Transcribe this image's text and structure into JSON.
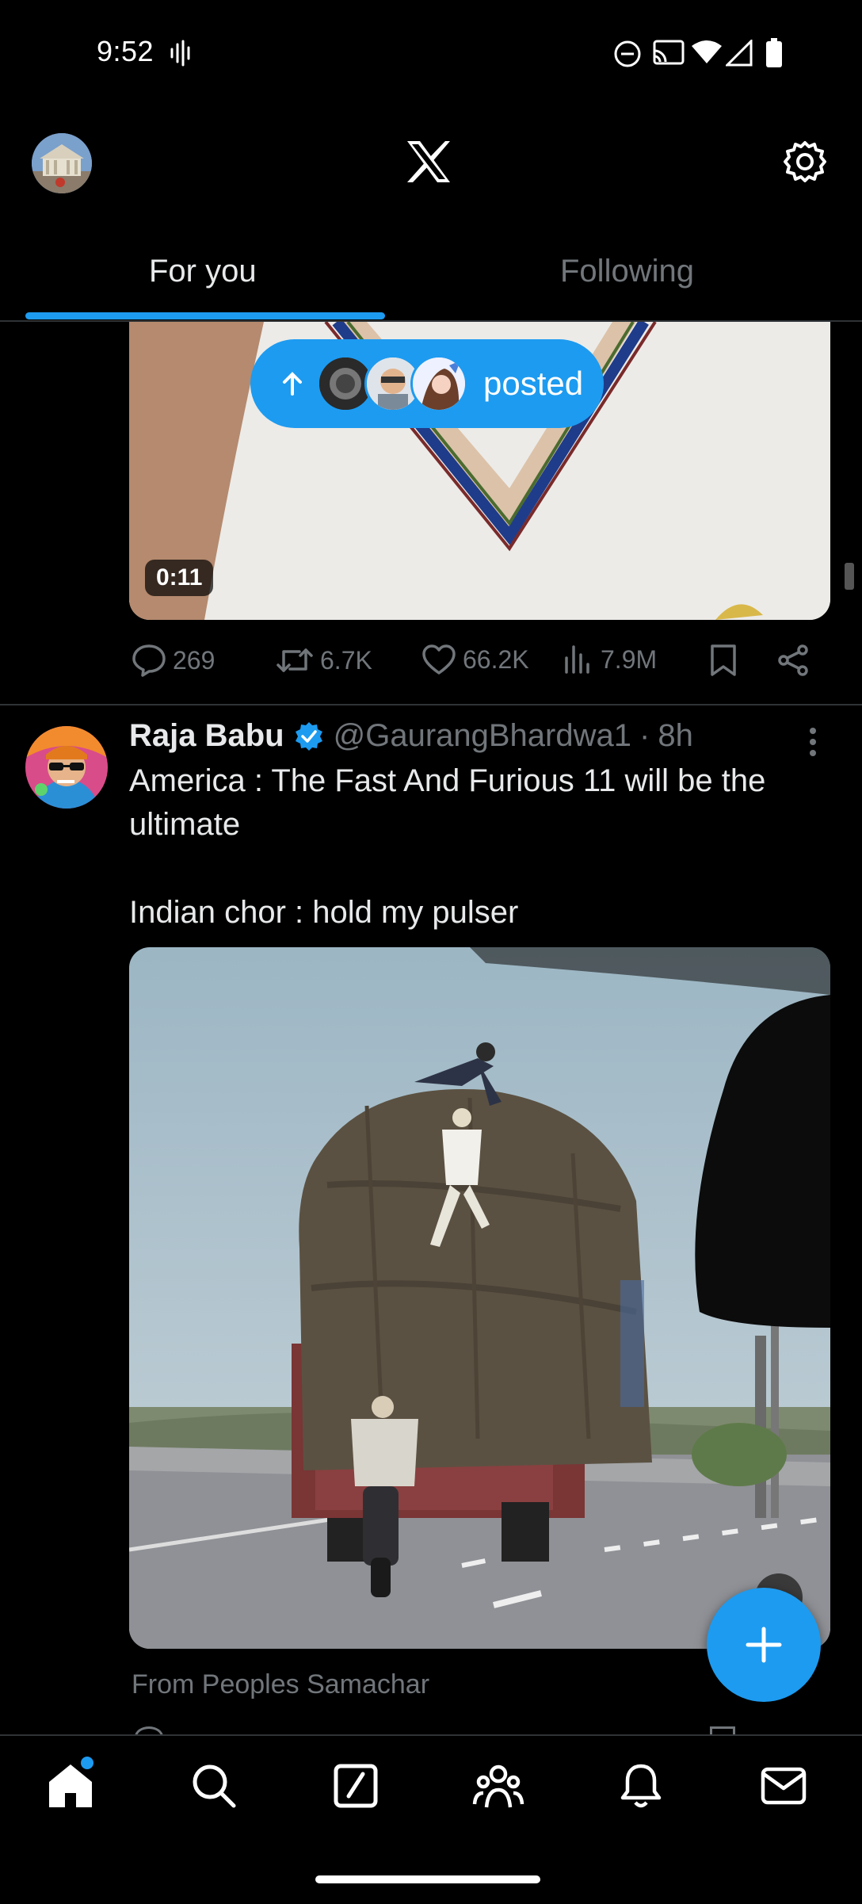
{
  "status_bar": {
    "time": "9:52"
  },
  "header": {
    "logo": "x-logo",
    "tabs": [
      {
        "label": "For you",
        "active": true
      },
      {
        "label": "Following",
        "active": false
      }
    ]
  },
  "new_posts_pill": {
    "label": "posted"
  },
  "tweet1": {
    "video_duration": "0:11",
    "actions": {
      "replies": "269",
      "reposts": "6.7K",
      "likes": "66.2K",
      "views": "7.9M"
    }
  },
  "tweet2": {
    "display_name": "Raja Babu",
    "handle": "@GaurangBhardwa1",
    "separator": "·",
    "time": "8h",
    "text_line1": "America : The Fast And Furious 11 will be the ultimate",
    "text_line2": "Indian chor : hold my pulser",
    "source": "From Peoples Samachar"
  },
  "bottom_nav": {
    "items": [
      "home-icon",
      "search-icon",
      "grok-icon",
      "communities-icon",
      "notifications-icon",
      "messages-icon"
    ]
  },
  "colors": {
    "accent": "#1d9bf0",
    "background": "#000000",
    "muted": "#71767b"
  }
}
